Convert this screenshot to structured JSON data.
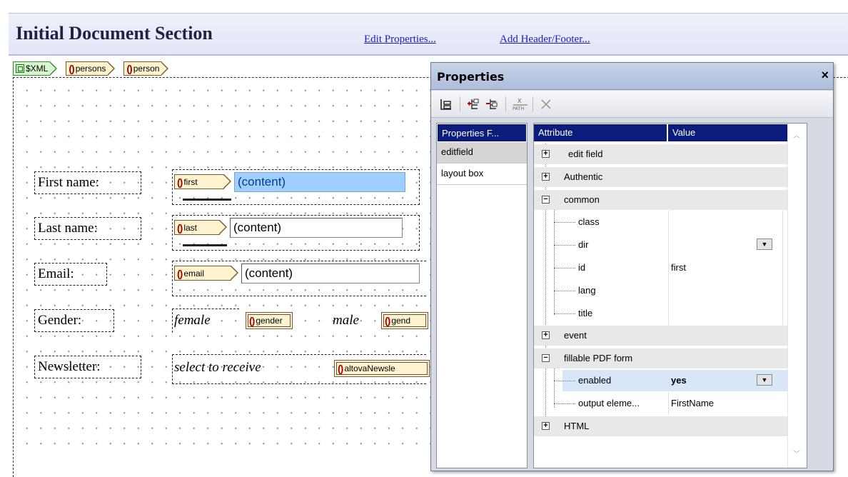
{
  "header": {
    "title": "Initial Document Section",
    "links": [
      "Edit Properties...",
      "Add Header/Footer..."
    ]
  },
  "breadcrumb": [
    "$XML",
    "persons",
    "person"
  ],
  "form": {
    "rows": [
      {
        "label": "First name:",
        "tag": "first",
        "value": "(content)"
      },
      {
        "label": "Last name:",
        "tag": "last",
        "value": "(content)"
      },
      {
        "label": "Email:",
        "tag": "email",
        "value": "(content)"
      }
    ],
    "gender": {
      "label": "Gender:",
      "option1": "female",
      "option2": "male",
      "tag1": "gender",
      "tag2": "gend"
    },
    "newsletter": {
      "label": "Newsletter:",
      "text": "select to receive",
      "tag": "altovaNewsle"
    }
  },
  "properties": {
    "title": "Properties",
    "close": "×",
    "toolbar": [
      "tree-view-icon",
      "add-attribute-icon",
      "remove-attribute-icon",
      "xpath-icon",
      "delete-icon"
    ],
    "left_header": "Properties F...",
    "left_items": [
      "editfield",
      "layout box"
    ],
    "columns": [
      "Attribute",
      "Value"
    ],
    "rows": [
      {
        "label": "edit field",
        "expander": "+",
        "level": 0
      },
      {
        "label": "Authentic",
        "expander": "+",
        "level": 0
      },
      {
        "label": "common",
        "expander": "−",
        "level": 0
      },
      {
        "label": "class",
        "level": 1,
        "value": ""
      },
      {
        "label": "dir",
        "level": 1,
        "value": "",
        "dropdown": true
      },
      {
        "label": "id",
        "level": 1,
        "value": "first"
      },
      {
        "label": "lang",
        "level": 1,
        "value": ""
      },
      {
        "label": "title",
        "level": 1,
        "value": ""
      },
      {
        "label": "event",
        "expander": "+",
        "level": 0
      },
      {
        "label": "fillable PDF form",
        "expander": "−",
        "level": 0
      },
      {
        "label": "enabled",
        "level": 1,
        "value": "yes",
        "dropdown": true,
        "selected": true
      },
      {
        "label": "output eleme...",
        "level": 1,
        "value": "FirstName"
      },
      {
        "label": "HTML",
        "expander": "+",
        "level": 0
      }
    ]
  },
  "colors": {
    "accent": "#0b1c7a",
    "selection": "#9fcfff",
    "tag_fill": "#fdf4cf",
    "row_selected": "#d8e7f7"
  }
}
